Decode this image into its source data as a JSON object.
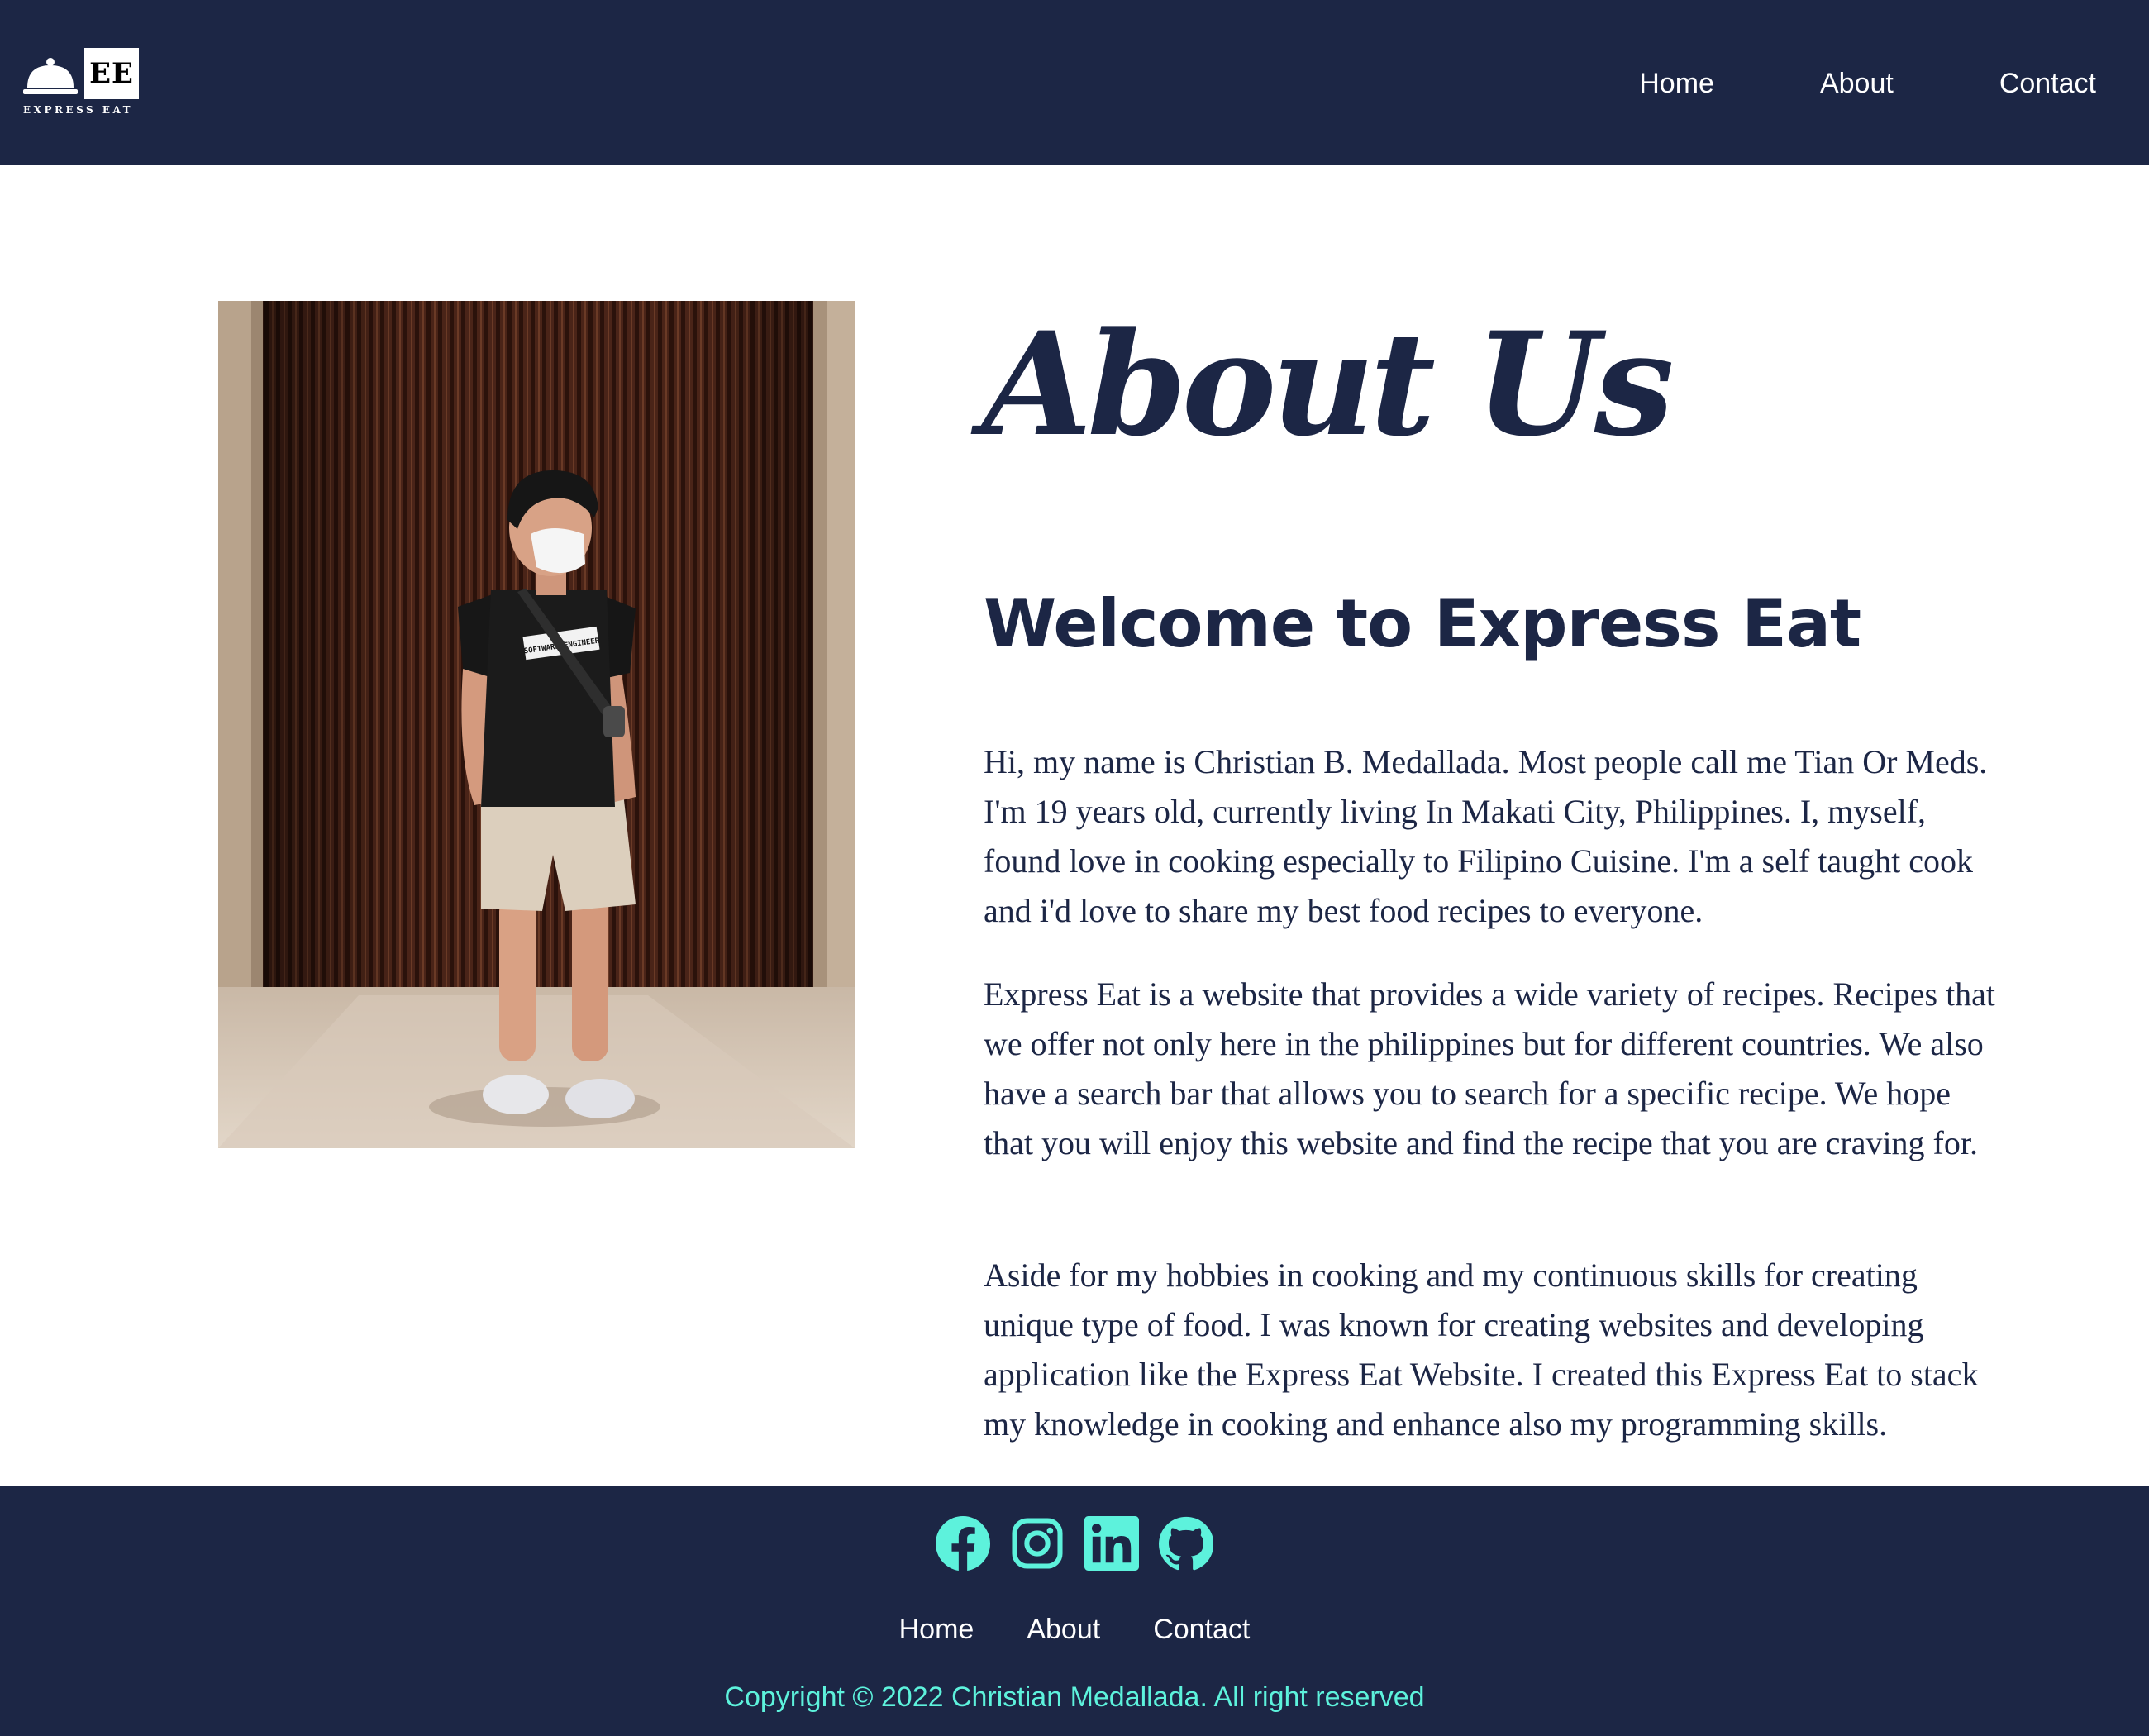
{
  "header": {
    "logo": {
      "monogram": "EE",
      "wordmark": "EXPRESS EAT",
      "icon": "cloche-icon"
    },
    "nav": [
      {
        "label": "Home"
      },
      {
        "label": "About"
      },
      {
        "label": "Contact"
      }
    ]
  },
  "main": {
    "photo": {
      "shirt_text": "SOFTWARE ENGINEER"
    },
    "title": "About Us",
    "subtitle": "Welcome to Express Eat",
    "paragraphs": [
      "Hi, my name is Christian B. Medallada. Most people call me Tian Or Meds. I'm 19 years old, currently living In Makati City, Philippines. I, myself, found love in cooking especially to Filipino Cuisine. I'm a self taught cook and i'd love to share my best food recipes to everyone.",
      "Express Eat is a website that provides a wide variety of recipes. Recipes that we offer not only here in the philippines but for different countries. We also have a search bar that allows you to search for a specific recipe. We hope that you will enjoy this website and find the recipe that you are craving for.",
      "Aside for my hobbies in cooking and my continuous skills for creating unique type of food. I was known for creating websites and developing application like the Express Eat Website. I created this Express Eat to stack my knowledge in cooking and enhance also my programming skills."
    ]
  },
  "footer": {
    "socials": [
      {
        "icon": "facebook-icon"
      },
      {
        "icon": "instagram-icon"
      },
      {
        "icon": "linkedin-icon"
      },
      {
        "icon": "github-icon"
      }
    ],
    "links": [
      {
        "label": "Home"
      },
      {
        "label": "About"
      },
      {
        "label": "Contact"
      }
    ],
    "copyright": "Copyright © 2022 Christian Medallada. All right reserved"
  },
  "colors": {
    "navy": "#1c2645",
    "accent": "#5df2dc",
    "background": "#ffffff"
  }
}
